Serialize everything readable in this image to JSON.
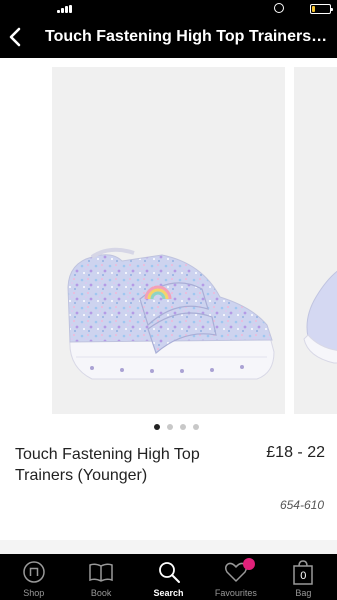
{
  "header": {
    "title": "Touch Fastening High Top Trainers (Younger)"
  },
  "status_bar": {
    "battery_level": 0.15,
    "battery_color": "#f2c230"
  },
  "carousel": {
    "slide_count": 4,
    "active_index": 0
  },
  "product": {
    "name": "Touch Fastening High Top Trainers (Younger)",
    "price": "£18 - 22",
    "code": "654-610"
  },
  "nav": {
    "items": [
      {
        "label": "Shop",
        "icon": "shop-icon"
      },
      {
        "label": "Book",
        "icon": "book-icon"
      },
      {
        "label": "Search",
        "icon": "search-icon"
      },
      {
        "label": "Favourites",
        "icon": "heart-icon"
      },
      {
        "label": "Bag",
        "icon": "bag-icon"
      }
    ],
    "active": "Search",
    "bag_count": "0",
    "badge_color": "#e0217a"
  }
}
